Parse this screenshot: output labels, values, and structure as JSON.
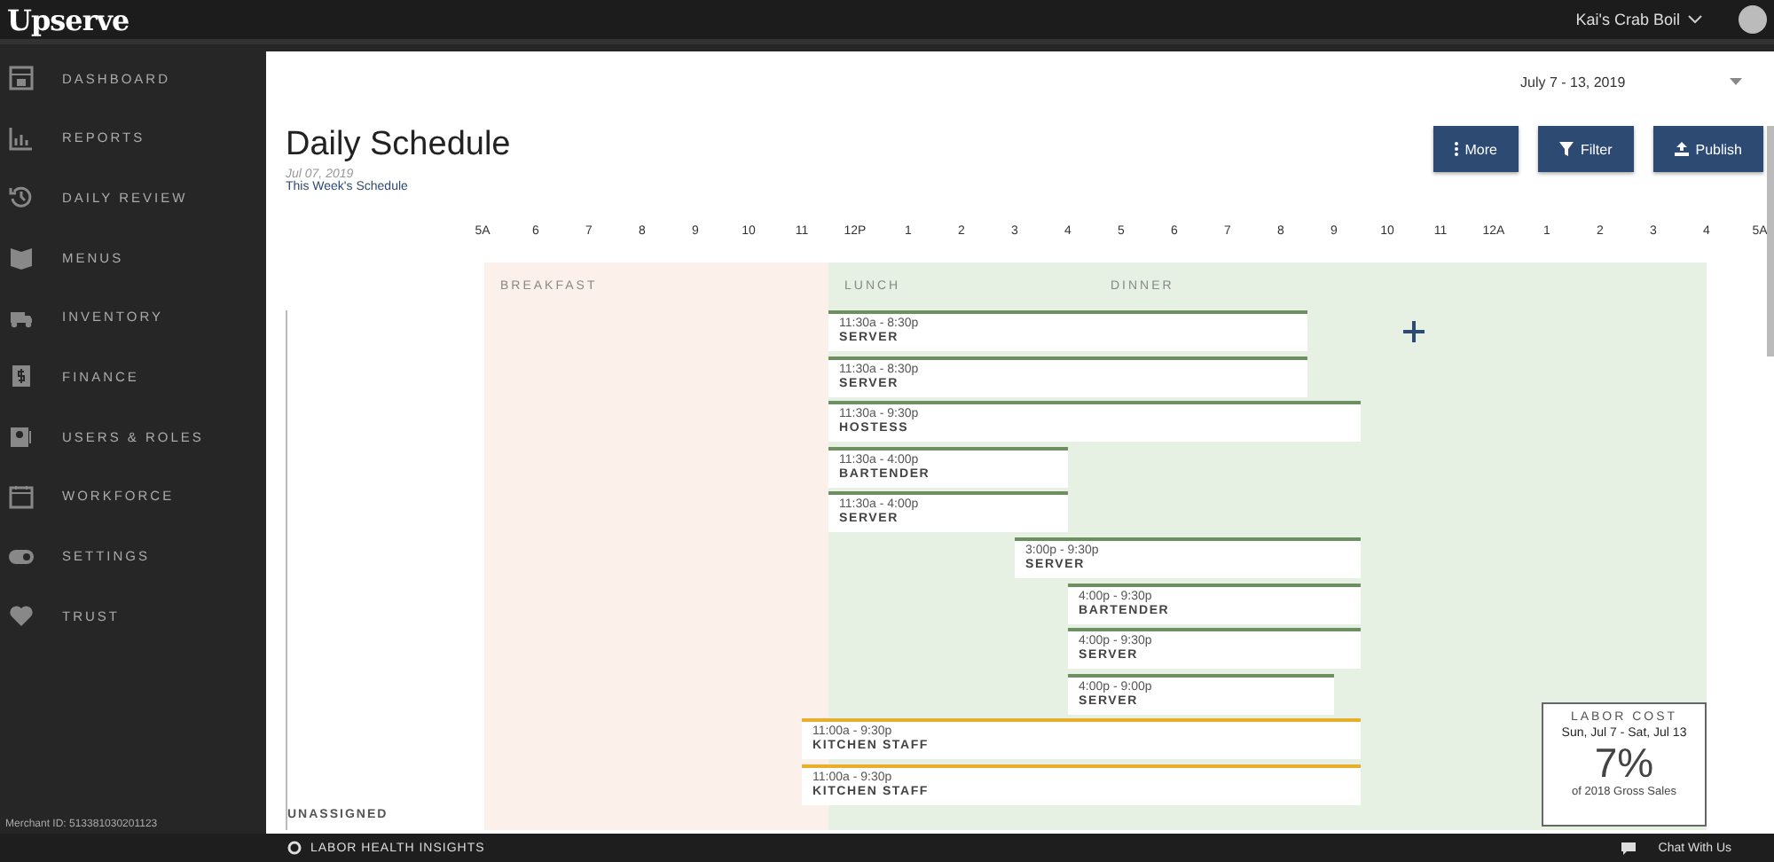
{
  "topbar": {
    "logo": "Upserve",
    "restaurant": "Kai's Crab Boil"
  },
  "sidebar": {
    "items": [
      {
        "label": "DASHBOARD",
        "kind": "calendar"
      },
      {
        "label": "REPORTS",
        "kind": "chart"
      },
      {
        "label": "DAILY REVIEW",
        "kind": "history"
      },
      {
        "label": "MENUS",
        "kind": "book"
      },
      {
        "label": "INVENTORY",
        "kind": "truck"
      },
      {
        "label": "FINANCE",
        "kind": "dollar"
      },
      {
        "label": "USERS & ROLES",
        "kind": "user"
      },
      {
        "label": "WORKFORCE",
        "kind": "schedule"
      },
      {
        "label": "SETTINGS",
        "kind": "toggle"
      },
      {
        "label": "TRUST",
        "kind": "heart"
      }
    ],
    "merchant_id": "Merchant ID: 513381030201123"
  },
  "date_range": "July 7 - 13, 2019",
  "header": {
    "title": "Daily Schedule",
    "date": "Jul 07, 2019",
    "link": "This Week's Schedule"
  },
  "buttons": [
    {
      "label": "More",
      "kind": "more"
    },
    {
      "label": "Filter",
      "kind": "filter"
    },
    {
      "label": "Publish",
      "kind": "upload"
    }
  ],
  "hours": [
    "5A",
    "6",
    "7",
    "8",
    "9",
    "10",
    "11",
    "12P",
    "1",
    "2",
    "3",
    "4",
    "5",
    "6",
    "7",
    "8",
    "9",
    "10",
    "11",
    "12A",
    "1",
    "2",
    "3",
    "4",
    "5A"
  ],
  "dayparts": [
    {
      "label": "BREAKFAST",
      "kind": "breakfast"
    },
    {
      "label": "LUNCH",
      "kind": "lunch"
    },
    {
      "label": "DINNER",
      "kind": "dinner"
    }
  ],
  "shifts": [
    {
      "time": "11:30a - 8:30p",
      "role": "SERVER",
      "color": "#6e8f62"
    },
    {
      "time": "11:30a - 8:30p",
      "role": "SERVER",
      "color": "#6e8f62"
    },
    {
      "time": "11:30a - 9:30p",
      "role": "HOSTESS",
      "color": "#6e8f62"
    },
    {
      "time": "11:30a - 4:00p",
      "role": "BARTENDER",
      "color": "#6e8f62"
    },
    {
      "time": "11:30a - 4:00p",
      "role": "SERVER",
      "color": "#6e8f62"
    },
    {
      "time": "3:00p - 9:30p",
      "role": "SERVER",
      "color": "#6e8f62"
    },
    {
      "time": "4:00p - 9:30p",
      "role": "BARTENDER",
      "color": "#6e8f62"
    },
    {
      "time": "4:00p - 9:30p",
      "role": "SERVER",
      "color": "#6e8f62"
    },
    {
      "time": "4:00p - 9:00p",
      "role": "SERVER",
      "color": "#6e8f62"
    },
    {
      "time": "11:00a - 9:30p",
      "role": "KITCHEN STAFF",
      "color": "#e8ae2c"
    },
    {
      "time": "11:00a - 9:30p",
      "role": "KITCHEN STAFF",
      "color": "#e8ae2c"
    }
  ],
  "unassigned": "UNASSIGNED",
  "labor_cost": {
    "title": "LABOR COST",
    "range": "Sun, Jul 7 - Sat, Jul 13",
    "value": "7%",
    "caption": "of 2018 Gross Sales"
  },
  "footer": {
    "insights": "LABOR HEALTH INSIGHTS",
    "chat": "Chat With Us"
  }
}
